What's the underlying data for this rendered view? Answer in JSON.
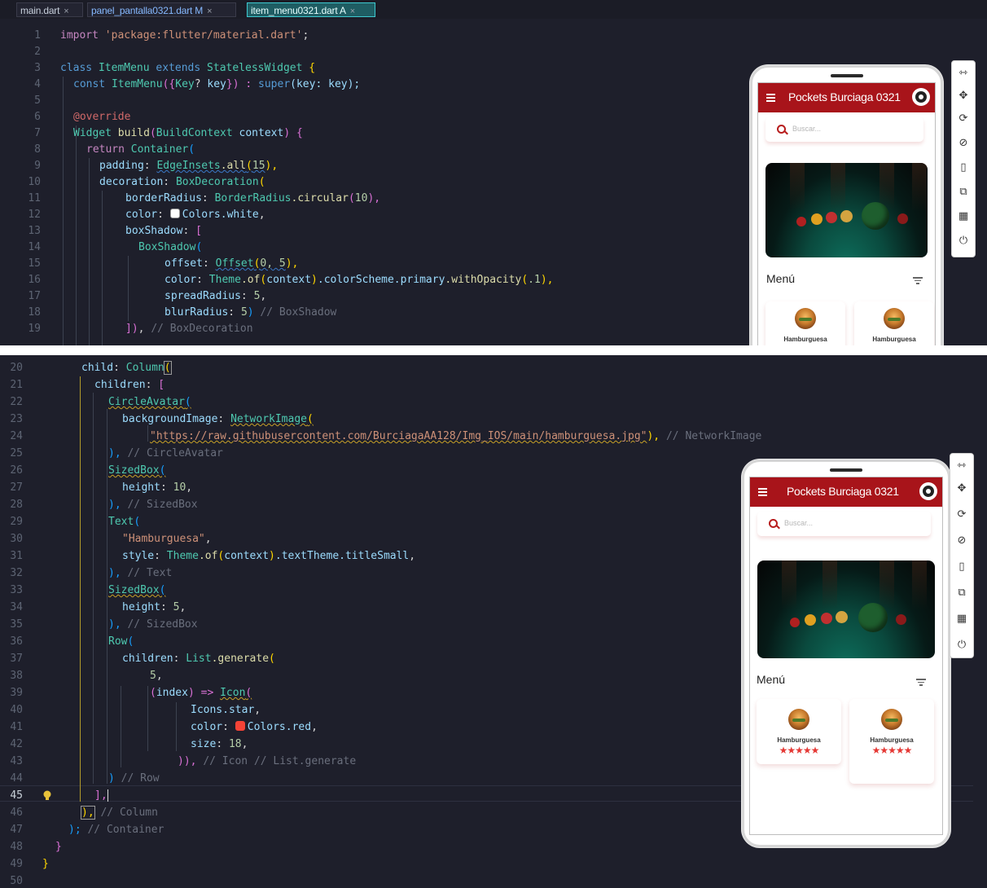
{
  "tabs": [
    {
      "label": "main.dart",
      "close": "×"
    },
    {
      "label": "panel_pantalla0321.dart M",
      "close": "×"
    },
    {
      "label": "item_menu0321.dart A",
      "close": "×"
    }
  ],
  "top_line_numbers": [
    "1",
    "2",
    "3",
    "4",
    "5",
    "6",
    "7",
    "8",
    "9",
    "10",
    "11",
    "12",
    "13",
    "14",
    "15",
    "16",
    "17",
    "18",
    "19"
  ],
  "bottom_line_numbers": [
    "20",
    "21",
    "22",
    "23",
    "24",
    "25",
    "26",
    "27",
    "28",
    "29",
    "30",
    "31",
    "32",
    "33",
    "34",
    "35",
    "36",
    "37",
    "38",
    "39",
    "40",
    "41",
    "42",
    "43",
    "44",
    "45",
    "46",
    "47",
    "48",
    "49",
    "50"
  ],
  "tokens": {
    "import": "import",
    "pkg": "'package:flutter/material.dart'",
    "semi": ";",
    "class": "class",
    "ItemMenu": "ItemMenu",
    "extends": "extends",
    "StatelessWidget": "StatelessWidget",
    "brace_open": "{",
    "const": "const",
    "ctor_args": "({",
    "Key": "Key",
    "key_q": "?",
    "key": "key",
    "ctor_close": "}) :",
    "super": "super",
    "super_args": "(key: key);",
    "override": "@override",
    "Widget": "Widget",
    "build": "build",
    "BuildContext": "BuildContext",
    "context": "context",
    "build_close": ") {",
    "return": "return",
    "Container": "Container",
    "paren_open": "(",
    "padding": "padding",
    "colon": ":",
    "EdgeInsets": "EdgeInsets",
    "all": ".all",
    "n15": "15",
    "close_comma": "),",
    "decoration": "decoration",
    "BoxDecoration": "BoxDecoration",
    "borderRadius": "borderRadius",
    "BorderRadius": "BorderRadius",
    "circular": ".circular",
    "n10": "10",
    "color": "color",
    "Colors_white": "Colors.white",
    "comma": ",",
    "boxShadow": "boxShadow",
    "bracket_open": "[",
    "BoxShadow": "BoxShadow",
    "offset": "offset",
    "Offset": "Offset",
    "offset_args": "0, 5",
    "Theme": "Theme",
    "of": ".of",
    "colorScheme": ".colorScheme",
    "primary": ".primary",
    "withOpacity": ".withOpacity",
    "op": ".1",
    "spreadRadius": "spreadRadius",
    "n5": "5",
    "blurRadius": "blurRadius",
    "c_boxshadow": "// BoxShadow",
    "bracket_close": "])",
    "c_boxdecoration": "// BoxDecoration",
    "child": "child",
    "Column": "Column",
    "children": "children",
    "CircleAvatar": "CircleAvatar",
    "backgroundImage": "backgroundImage",
    "NetworkImage": "NetworkImage",
    "url": "\"https://raw.githubusercontent.com/BurciagaAA128/Img_IOS/main/hamburguesa.jpg\"",
    "c_networkimage": "// NetworkImage",
    "c_circleavatar": "// CircleAvatar",
    "SizedBox": "SizedBox",
    "height": "height",
    "c_sizedbox": "// SizedBox",
    "Text": "Text",
    "hamb_str": "\"Hamburguesa\"",
    "style": "style",
    "textTheme": ".textTheme",
    "titleSmall": ".titleSmall",
    "c_text": "// Text",
    "Row": "Row",
    "List": "List",
    "generate": ".generate",
    "index": "index",
    "arrow": ") =>",
    "Icon": "Icon",
    "Icons_star": "Icons.star",
    "Colors_red": "Colors.red",
    "size": "size",
    "n18": "18",
    "close_icon": ")),",
    "c_icon": "// Icon // List.generate",
    "c_row": "// Row",
    "bracket_close2": "],",
    "col_close": "),",
    "c_column": "// Column",
    "cont_close": ");",
    "c_container": "// Container",
    "brace_close": "}"
  },
  "phone": {
    "app_title": "Pockets Burciaga 0321",
    "search_placeholder": "Buscar...",
    "menu_title": "Menú",
    "item_name": "Hamburguesa",
    "stars": "★★★★★"
  },
  "toolbar_icons": [
    "⇿",
    "✥",
    "⟳",
    "⊘",
    "▯",
    "⧉",
    "▦",
    "⏻"
  ],
  "colors": {
    "appbar": "#a8141a",
    "editor_bg": "#1e1f2b",
    "star": "#e53935"
  }
}
